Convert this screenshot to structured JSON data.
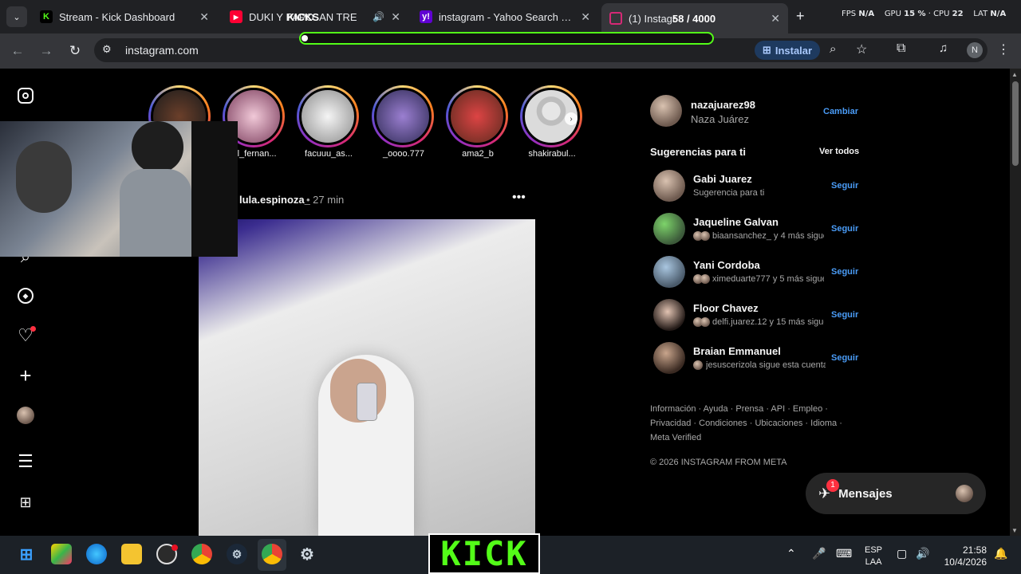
{
  "browser": {
    "tabs": [
      {
        "title": "Stream - Kick Dashboard",
        "favicon": "kick-icon",
        "color": "#53fc18"
      },
      {
        "title": "DUKI Y PAPO",
        "overlay_text": "KICKS",
        "title_tail": "AN TRE",
        "favicon": "youtube-icon",
        "color": "#ff0033"
      },
      {
        "title": "instagram - Yahoo Search Tus r",
        "favicon": "yahoo-icon",
        "color": "#6001d2"
      },
      {
        "title": "(1) Instagr",
        "counter": "58 / 4000",
        "favicon": "instagram-icon",
        "color": "#d62976"
      }
    ],
    "stats": {
      "fps_label": "FPS",
      "fps": "N/A",
      "gpu_label": "GPU",
      "gpu": "15 %",
      "cpu_label": "CPU",
      "cpu": "22",
      "lat_label": "LAT",
      "lat": "N/A"
    },
    "url": "instagram.com",
    "install_label": "Instalar",
    "profile_initial": "N"
  },
  "stories": [
    {
      "name": ""
    },
    {
      "name": "el_fernan..."
    },
    {
      "name": "facuuu_as..."
    },
    {
      "name": "_oooo.777"
    },
    {
      "name": "ama2_b"
    },
    {
      "name": "shakirabul..."
    }
  ],
  "post": {
    "author": "lula.espinoza_",
    "time": "• 27 min",
    "more": "•••"
  },
  "sidebar": {
    "account": {
      "username": "nazajuarez98",
      "fullname": "Naza Juárez",
      "switch_label": "Cambiar"
    },
    "suggestions_title": "Sugerencias para ti",
    "see_all": "Ver todos",
    "suggestions": [
      {
        "name": "Gabi Juarez",
        "sub": "Sugerencia para ti",
        "action": "Seguir"
      },
      {
        "name": "Jaqueline Galvan",
        "sub": "biaansanchez_ y 4 más siguen",
        "action": "Seguir"
      },
      {
        "name": "Yani Cordoba",
        "sub": "ximeduarte777 y 5 más siguen",
        "action": "Seguir"
      },
      {
        "name": "Floor Chavez",
        "sub": "delfi.juarez.12 y 15 más siguen",
        "action": "Seguir"
      },
      {
        "name": "Braian Emmanuel",
        "sub": "jesuscerizola sigue esta cuenta",
        "action": "Seguir"
      }
    ],
    "footer_lines": [
      "Información · Ayuda · Prensa · API · Empleo ·",
      "Privacidad · Condiciones · Ubicaciones · Idioma ·",
      "Meta Verified"
    ],
    "copyright": "© 2026 INSTAGRAM FROM META"
  },
  "messages": {
    "label": "Mensajes",
    "badge": "1"
  },
  "taskbar": {
    "kick_logo": "KICK",
    "lang_top": "ESP",
    "lang_bottom": "LAA",
    "time": "21:58",
    "date": "10/4/2026"
  }
}
